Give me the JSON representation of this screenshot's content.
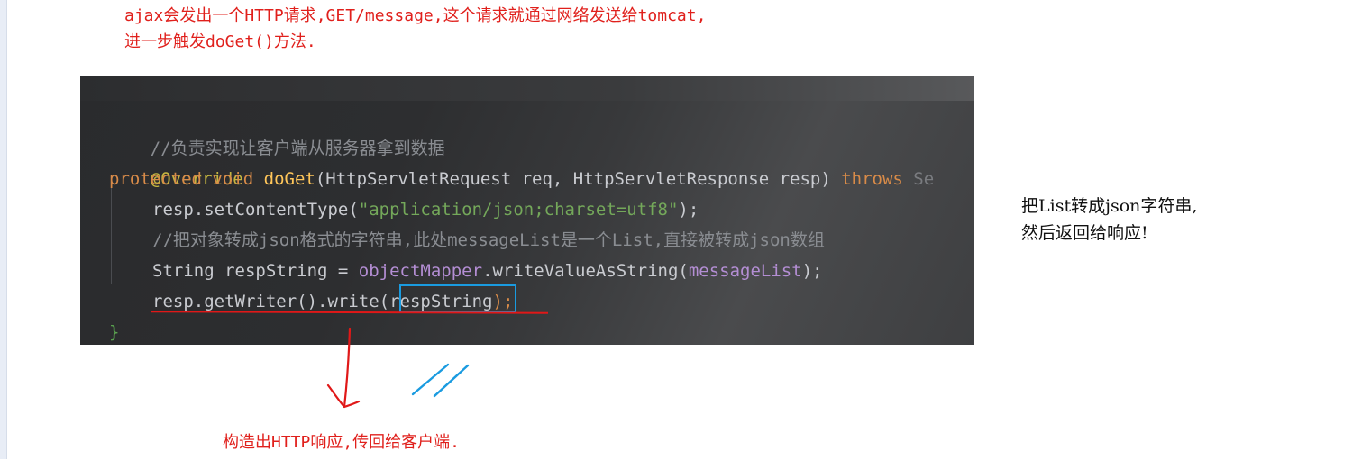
{
  "notes": {
    "top_line1": "ajax会发出一个HTTP请求,GET/message,这个请求就通过网络发送给tomcat,",
    "top_line2": "进一步触发doGet()方法.",
    "right_line1": "把List转成json字符串,",
    "right_line2": "然后返回给响应!",
    "bottom": "构造出HTTP响应,传回给客户端."
  },
  "code": {
    "comment1": "//负责实现让客户端从服务器拿到数据",
    "annotation": "@Override",
    "kw_protected": "protected",
    "kw_void": "void",
    "method_name": "doGet",
    "params": "(HttpServletRequest req, HttpServletResponse resp) ",
    "kw_throws": "throws",
    "throws_rest": " Se",
    "l4_pre": "resp.setContentType(",
    "l4_str": "\"application/json;charset=utf8\"",
    "l4_post": ");",
    "comment2": "//把对象转成json格式的字符串,此处messageList是一个List,直接被转成json数组",
    "l6_pre": "String respString = ",
    "l6_field1": "objectMapper",
    "l6_mid": ".writeValueAsString(",
    "l6_field2": "messageList",
    "l6_post": ");",
    "l7_pre": "resp.getWriter().write(",
    "l7_arg": "respString",
    "l7_post": ");",
    "close_brace": "}"
  },
  "colors": {
    "note_red": "#e0201c",
    "highlight_blue": "#1a9be0",
    "code_bg": "#2b2b2b"
  }
}
